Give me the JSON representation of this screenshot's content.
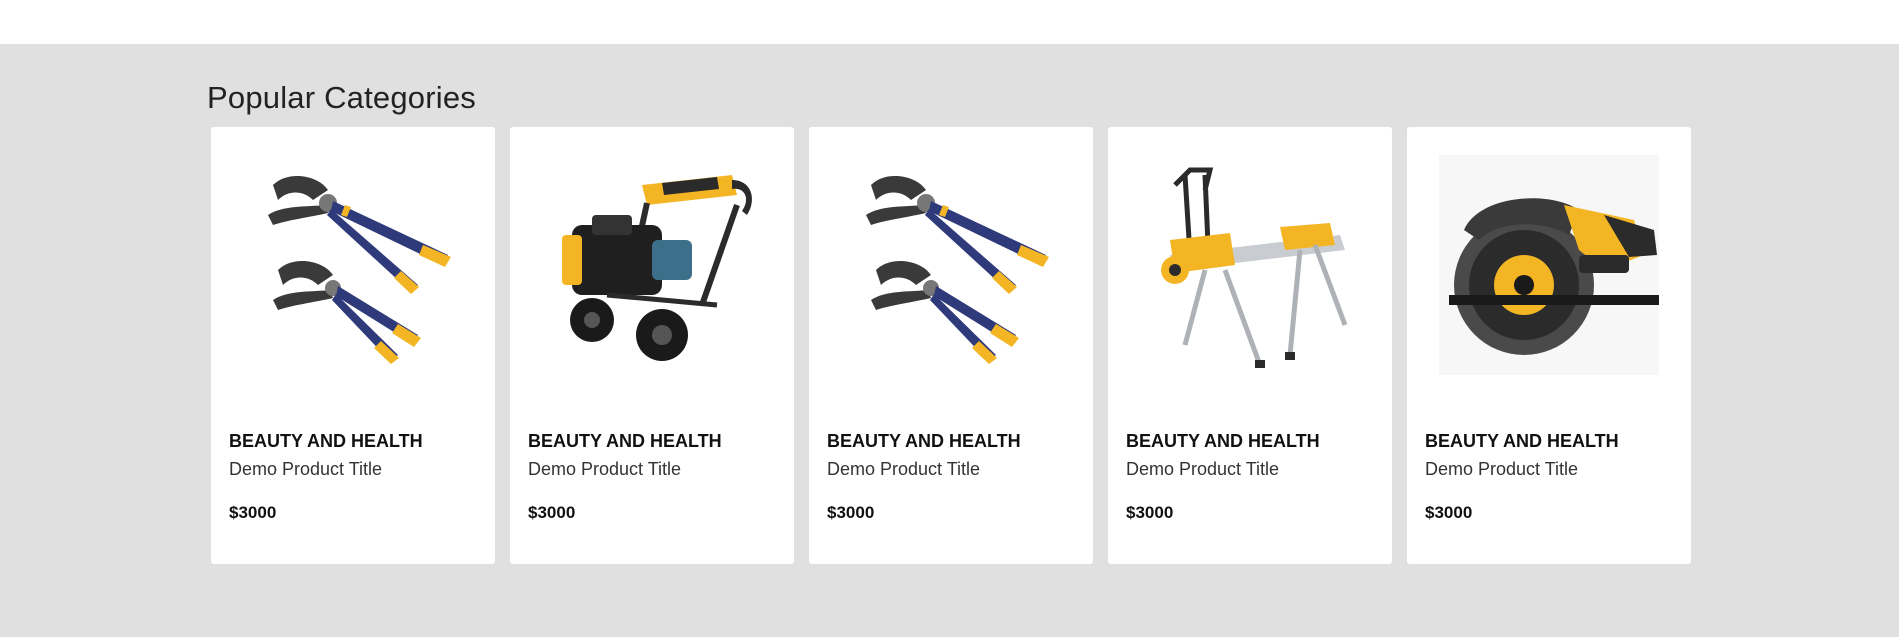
{
  "section": {
    "heading": "Popular Categories"
  },
  "colors": {
    "background": "#e0e0e0",
    "card": "#ffffff",
    "tool_yellow": "#f3b523",
    "tool_navy": "#2e3a7a",
    "tool_dark": "#2b2b2b"
  },
  "products": [
    {
      "category": "BEAUTY AND HEALTH",
      "title": "Demo Product Title",
      "price": "$3000",
      "image": "pliers-icon"
    },
    {
      "category": "BEAUTY AND HEALTH",
      "title": "Demo Product Title",
      "price": "$3000",
      "image": "pressure-washer-icon"
    },
    {
      "category": "BEAUTY AND HEALTH",
      "title": "Demo Product Title",
      "price": "$3000",
      "image": "pliers-icon"
    },
    {
      "category": "BEAUTY AND HEALTH",
      "title": "Demo Product Title",
      "price": "$3000",
      "image": "miter-saw-stand-icon"
    },
    {
      "category": "BEAUTY AND HEALTH",
      "title": "Demo Product Title",
      "price": "$3000",
      "image": "circular-saw-icon"
    }
  ]
}
